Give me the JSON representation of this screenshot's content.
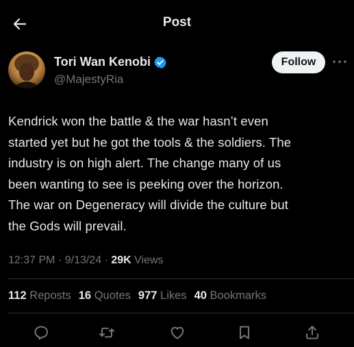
{
  "header": {
    "title": "Post",
    "back_icon": "arrow-left-icon"
  },
  "author": {
    "display_name": "Tori Wan Kenobi",
    "handle": "@MajestyRia",
    "verified_icon": "verified-badge-icon",
    "verified_color": "#1d9bf0"
  },
  "follow_label": "Follow",
  "more_icon": "more-dots-icon",
  "tweet": {
    "lines": [
      "Kendrick won the battle & the war hasn’t even",
      "started yet but he got the tools & the soldiers. The",
      "industry is on high alert. The change many of us",
      "been wanting to see is peeking over the horizon.",
      "The war on Degeneracy will divide the culture but",
      "the Gods will prevail."
    ]
  },
  "meta": {
    "time": "12:37 PM",
    "separator": "·",
    "date": "9/13/24",
    "views_count": "29K",
    "views_label": "Views"
  },
  "stats": {
    "reposts": {
      "count": "112",
      "label": "Reposts"
    },
    "quotes": {
      "count": "16",
      "label": "Quotes"
    },
    "likes": {
      "count": "977",
      "label": "Likes"
    },
    "bookmarks": {
      "count": "40",
      "label": "Bookmarks"
    }
  },
  "actions": [
    "reply-icon",
    "repost-icon",
    "like-icon",
    "bookmark-icon",
    "share-icon"
  ],
  "colors": {
    "background": "#000000",
    "text": "#e7e9ea",
    "secondary": "#71767b",
    "divider": "#2f3336",
    "follow_bg": "#eff3f4"
  }
}
